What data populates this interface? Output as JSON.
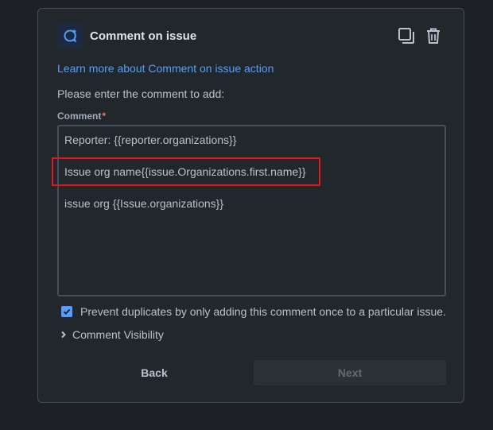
{
  "header": {
    "title": "Comment on issue",
    "app_icon": "comment-icon",
    "actions": [
      "copy-icon",
      "trash-icon"
    ]
  },
  "learn_link": "Learn more about Comment on issue action",
  "prompt": "Please enter the comment to add:",
  "comment_field": {
    "label": "Comment",
    "required_mark": "*",
    "lines": [
      "Reporter: {{reporter.organizations}}",
      "Issue org name{{issue.Organizations.first.name}}",
      "issue org {{Issue.organizations}}"
    ]
  },
  "prevent_duplicates": {
    "checked": true,
    "label": "Prevent duplicates by only adding this comment once to a particular issue."
  },
  "comment_visibility": {
    "label": "Comment Visibility",
    "expanded": false
  },
  "footer": {
    "back_label": "Back",
    "next_label": "Next",
    "next_disabled": true
  },
  "colors": {
    "accent": "#579dff",
    "annotation": "#e2141e",
    "required": "#f87168"
  }
}
